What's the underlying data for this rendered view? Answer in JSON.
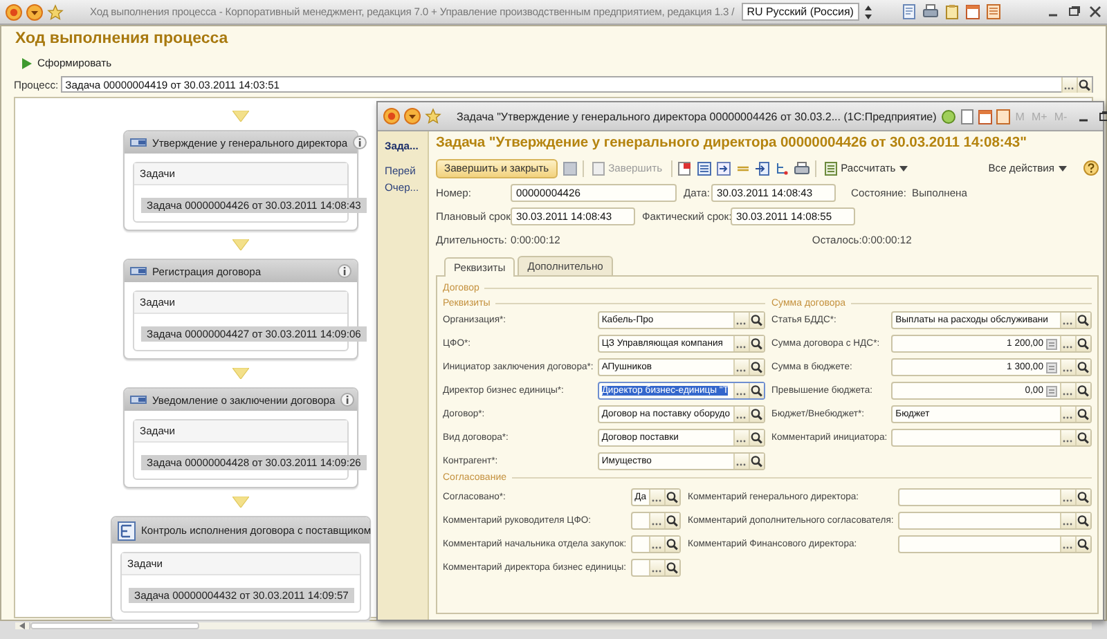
{
  "titlebar": {
    "title": "Ход выполнения процесса - Корпоративный менеджмент, редакция 7.0 + Управление производственным предприятием, редакция 1.3 /",
    "language": "RU Русский (Россия)"
  },
  "page": {
    "title": "Ход выполнения процесса",
    "generate_button": "Сформировать",
    "process": {
      "label": "Процесс:",
      "value": "Задача 00000004419 от 30.03.2011 14:03:51"
    }
  },
  "process_steps": [
    {
      "kind": "task",
      "title": "Утверждение у генерального директора",
      "tasks_header": "Задачи",
      "task": "Задача 00000004426 от 30.03.2011 14:08:43"
    },
    {
      "kind": "task",
      "title": "Регистрация договора",
      "tasks_header": "Задачи",
      "task": "Задача 00000004427 от 30.03.2011 14:09:06"
    },
    {
      "kind": "task",
      "title": "Уведомление о заключении договора",
      "tasks_header": "Задачи",
      "task": "Задача 00000004428 от 30.03.2011 14:09:26"
    },
    {
      "kind": "subprocess",
      "title": "Контроль исполнения договора с поставщиком",
      "tasks_header": "Задачи",
      "task": "Задача 00000004432 от 30.03.2011 14:09:57"
    }
  ],
  "dialog": {
    "window_title": "Задача \"Утверждение у генерального директора  00000004426 от 30.03.2...  (1С:Предприятие)",
    "memory_buttons": [
      "M",
      "M+",
      "M-"
    ],
    "nav": [
      {
        "label": "Зада...",
        "selected": true
      },
      {
        "label": "Перей",
        "selected": false
      },
      {
        "label": "Очер...",
        "selected": false
      }
    ],
    "heading": "Задача \"Утверждение у генерального директора  00000004426 от 30.03.2011 14:08:43\"",
    "toolbar": {
      "primary": "Завершить и закрыть",
      "complete": {
        "label": "Завершить",
        "disabled": true
      },
      "calculate": "Рассчитать",
      "all_actions": "Все действия"
    },
    "header": {
      "number": {
        "label": "Номер:",
        "value": "00000004426"
      },
      "date": {
        "label": "Дата:",
        "value": "30.03.2011 14:08:43"
      },
      "state": {
        "label": "Состояние:",
        "value": "Выполнена"
      },
      "planned": {
        "label": "Плановый срок:",
        "value": "30.03.2011 14:08:43"
      },
      "actual": {
        "label": "Фактический срок:",
        "value": "30.03.2011 14:08:55"
      },
      "duration": {
        "label": "Длительность:",
        "value": "0:00:00:12"
      },
      "remaining": {
        "label": "Осталось:",
        "value": "0:00:00:12"
      }
    },
    "tabs": [
      {
        "label": "Реквизиты",
        "selected": true
      },
      {
        "label": "Дополнительно",
        "selected": false
      }
    ],
    "groups": [
      {
        "title": "Договор",
        "columns": [
          {
            "title": "Реквизиты",
            "fields": [
              {
                "label": "Организация*:",
                "value": "Кабель-Про",
                "kind": "ref",
                "highlighted": false
              },
              {
                "label": "ЦФО*:",
                "value": "ЦЗ Управляющая компания",
                "kind": "ref",
                "highlighted": false
              },
              {
                "label": "Инициатор заключения договора*:",
                "value": "АПушников",
                "kind": "ref",
                "highlighted": false
              },
              {
                "label": "Директор бизнес единицы*:",
                "value": "Директор бизнес-единицы \"Т",
                "kind": "ref",
                "highlighted": true
              },
              {
                "label": "Договор*:",
                "value": "Договор на поставку оборудо",
                "kind": "ref",
                "highlighted": false
              },
              {
                "label": "Вид договора*:",
                "value": "Договор поставки",
                "kind": "ref",
                "highlighted": false
              },
              {
                "label": "Контрагент*:",
                "value": "Имущество",
                "kind": "ref",
                "highlighted": false
              }
            ]
          },
          {
            "title": "Сумма договора",
            "fields": [
              {
                "label": "Статья БДДС*:",
                "value": "Выплаты на расходы обслуживани",
                "kind": "ref",
                "highlighted": false
              },
              {
                "label": "Сумма договора с НДС*:",
                "value": "1 200,00",
                "kind": "number",
                "highlighted": false
              },
              {
                "label": "Сумма в бюджете:",
                "value": "1 300,00",
                "kind": "number",
                "highlighted": false
              },
              {
                "label": "Превышение бюджета:",
                "value": "0,00",
                "kind": "number",
                "highlighted": false
              },
              {
                "label": "Бюджет/Внебюджет*:",
                "value": "Бюджет",
                "kind": "ref",
                "highlighted": false
              },
              {
                "label": "Комментарий инициатора:",
                "kind": "ref",
                "highlighted": false
              }
            ]
          }
        ]
      },
      {
        "title": "Согласование",
        "columns": [
          {
            "fields": [
              {
                "label": "Согласовано*:",
                "value": "Да",
                "kind": "ref",
                "highlighted": false
              },
              {
                "label": "Комментарий руководителя ЦФО:",
                "kind": "ref",
                "highlighted": false
              },
              {
                "label": "Комментарий начальника отдела закупок:",
                "kind": "ref",
                "highlighted": false
              },
              {
                "label": "Комментарий директора бизнес единицы:",
                "kind": "ref",
                "highlighted": false
              }
            ]
          },
          {
            "fields": [
              {
                "label": "Комментарий генерального директора:",
                "kind": "ref",
                "highlighted": false
              },
              {
                "label": "Комментарий дополнительного согласователя:",
                "kind": "ref",
                "highlighted": false
              },
              {
                "label": "Комментарий Финансового директора:",
                "kind": "ref",
                "highlighted": false
              }
            ]
          }
        ]
      }
    ]
  }
}
